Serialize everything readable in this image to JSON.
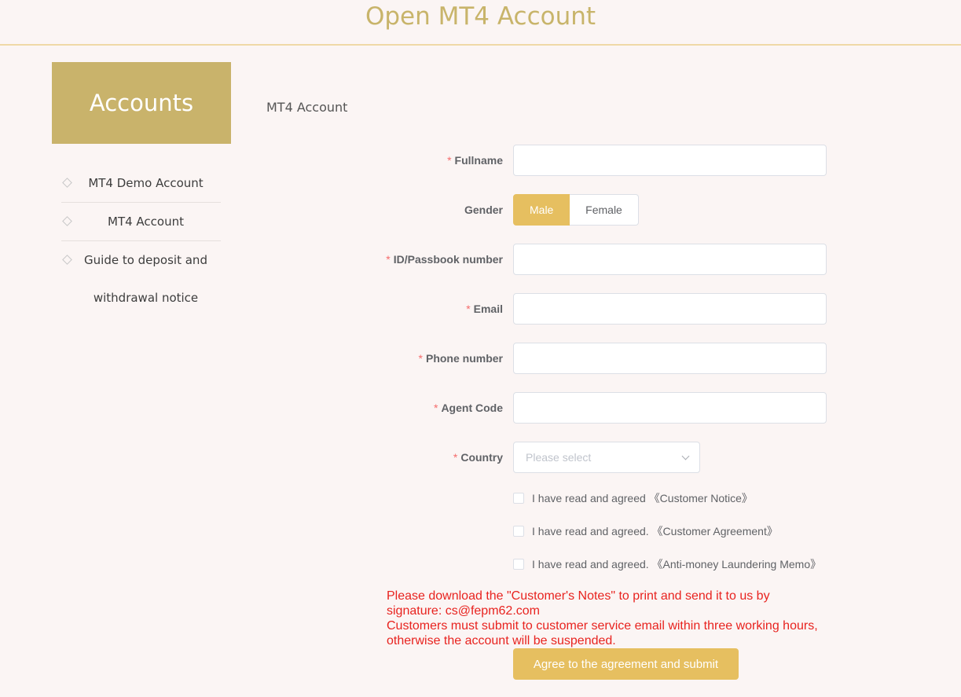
{
  "header": {
    "title": "Open MT4 Account"
  },
  "sidebar": {
    "title": "Accounts",
    "items": [
      {
        "label": "MT4 Demo Account"
      },
      {
        "label": "MT4 Account"
      },
      {
        "label": "Guide to deposit and withdrawal notice"
      }
    ]
  },
  "main": {
    "section_label": "MT4 Account",
    "required_mark": "*",
    "fields": {
      "fullname": {
        "label": "Fullname",
        "value": ""
      },
      "gender": {
        "label": "Gender",
        "options": [
          "Male",
          "Female"
        ],
        "selected": "Male"
      },
      "id_number": {
        "label": "ID/Passbook number",
        "value": ""
      },
      "email": {
        "label": "Email",
        "value": ""
      },
      "phone": {
        "label": "Phone number",
        "value": ""
      },
      "agent_code": {
        "label": "Agent Code",
        "value": ""
      },
      "country": {
        "label": "Country",
        "placeholder": "Please select"
      }
    },
    "checkboxes": [
      {
        "label": "I have read and agreed 《Customer Notice》",
        "checked": false
      },
      {
        "label": "I have read and agreed. 《Customer Agreement》",
        "checked": false
      },
      {
        "label": "I have read and agreed. 《Anti-money Laundering Memo》",
        "checked": false
      }
    ],
    "notice": {
      "line1": "Please download the \"Customer's Notes\" to print and send it to us by signature: cs@fepm62.com",
      "line2": "Customers must submit to customer service email within three working hours, otherwise the account will be suspended."
    },
    "submit_label": "Agree to the agreement and submit"
  },
  "colors": {
    "accent": "#e6bf60",
    "sidebar_title_bg": "#c9b36b",
    "header_title": "#c8b46a",
    "required": "#f56c6c",
    "notice": "#e8231f",
    "background": "#fbf5f4"
  },
  "icons": {
    "menu_bullet": "diamond-icon",
    "select_arrow": "chevron-down-icon"
  }
}
